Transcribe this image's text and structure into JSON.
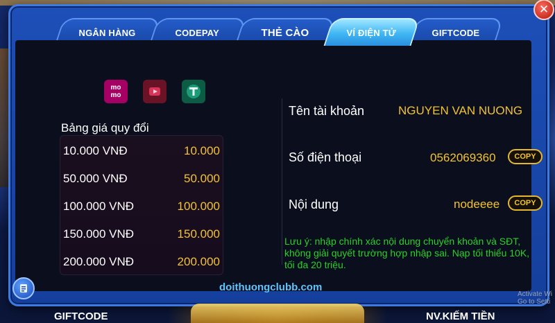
{
  "tabs": [
    {
      "label": "NGÂN HÀNG",
      "active": false
    },
    {
      "label": "CODEPAY",
      "active": false
    },
    {
      "label": "THẺ CÀO",
      "active": false
    },
    {
      "label": "VÍ ĐIỆN TỬ",
      "active": true
    },
    {
      "label": "GIFTCODE",
      "active": false
    }
  ],
  "close_label": "✕",
  "wallets": {
    "momo_label": "mo\nmo",
    "icons": [
      "momo-icon",
      "viettel-money-icon",
      "usdt-tether-icon"
    ]
  },
  "price_table": {
    "title": "Bảng giá quy đổi",
    "rows": [
      {
        "vnd": "10.000 VNĐ",
        "value": "10.000"
      },
      {
        "vnd": "50.000 VNĐ",
        "value": "50.000"
      },
      {
        "vnd": "100.000 VNĐ",
        "value": "100.000"
      },
      {
        "vnd": "150.000 VNĐ",
        "value": "150.000"
      },
      {
        "vnd": "200.000 VNĐ",
        "value": "200.000"
      }
    ]
  },
  "account": {
    "name_label": "Tên tài khoản",
    "name_value": "NGUYEN VAN NUONG",
    "phone_label": "Số điện thoại",
    "phone_value": "0562069360",
    "content_label": "Nội dung",
    "content_value": "nodeeee",
    "copy_label": "COPY"
  },
  "note": "Lưu ý: nhập chính xác nội dung chuyển khoản và SĐT, không giải quyết trường hợp nhập sai. Nạp tối thiểu 10K, tối đa 20 triệu.",
  "site_url": "doithuongclubb.com",
  "bottom": {
    "left_label": "GIFTCODE",
    "right_label": "NV.KIẾM TIỀN"
  },
  "watermark": "Activate Wi\nGo to Setti",
  "colors": {
    "accent_gold": "#f2c233",
    "note_green": "#29d12a",
    "url_blue": "#5fc4ff",
    "active_tab": "#3fb6f3"
  }
}
